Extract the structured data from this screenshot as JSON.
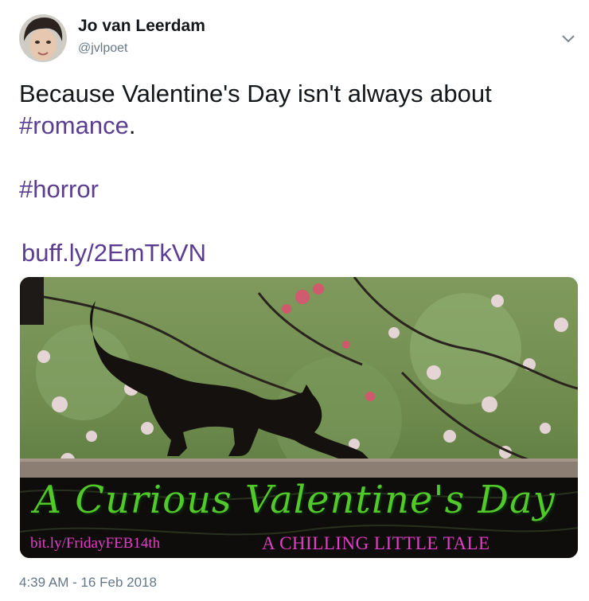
{
  "user": {
    "display_name": "Jo van Leerdam",
    "handle": "@jvlpoet",
    "avatar_icon": "user-avatar-photo"
  },
  "menu": {
    "icon": "chevron-down-icon"
  },
  "tweet": {
    "line1": "Because Valentine's Day isn't always about",
    "hashtag_romance": "#romance",
    "line2_suffix": ".",
    "hashtag_horror": "#horror",
    "link": "buff.ly/2EmTkVN"
  },
  "card": {
    "title": "A Curious Valentine's Day",
    "url": "bit.ly/FridayFEB14th",
    "tagline": "A CHILLING LITTLE TALE",
    "title_color": "#52c92a",
    "accent_color": "#e33ec7"
  },
  "timestamp": "4:39 AM - 16 Feb 2018",
  "colors": {
    "link_color": "#5b3d91",
    "muted_text": "#657786"
  }
}
